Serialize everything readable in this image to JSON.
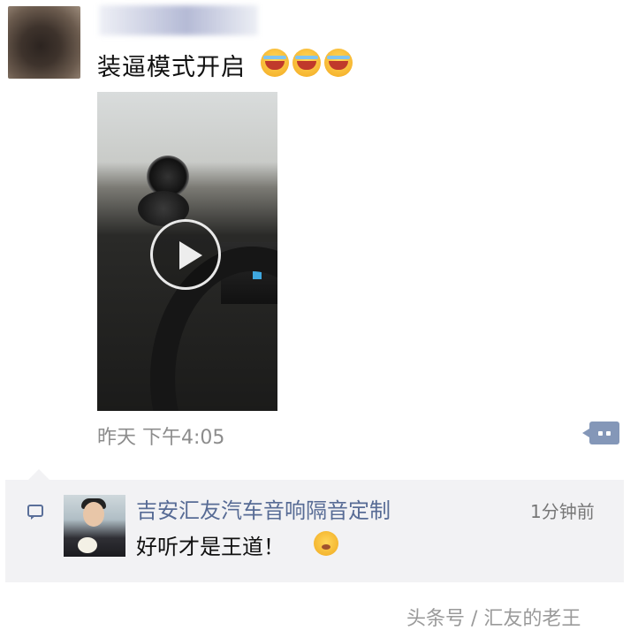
{
  "post": {
    "text": "装逼模式开启",
    "emojis": [
      "crying-laughing-icon",
      "crying-laughing-icon",
      "crying-laughing-icon"
    ],
    "timestamp": "昨天 下午4:05"
  },
  "comment": {
    "author": "吉安汇友汽车音响隔音定制",
    "time": "1分钟前",
    "text": "好听才是王道！",
    "emoji": "grin-icon"
  },
  "watermark": "头条号 / 汇友的老王",
  "colors": {
    "link": "#576b95",
    "comment_bg": "#f2f2f4",
    "more_button": "#8497b8"
  }
}
